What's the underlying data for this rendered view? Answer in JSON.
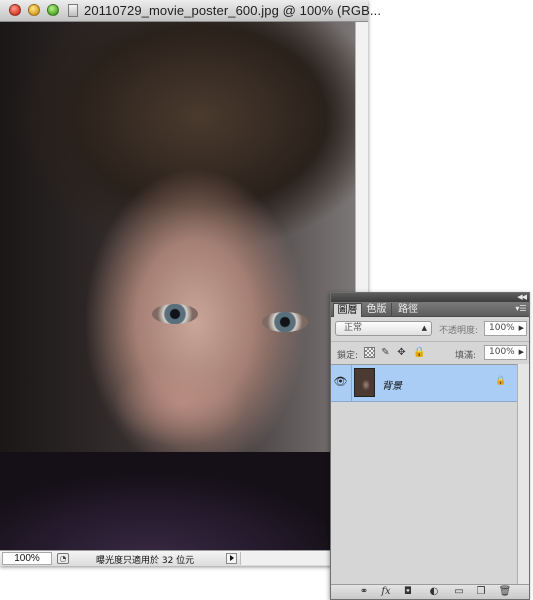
{
  "window": {
    "title": "20110729_movie_poster_600.jpg @ 100% (RGB..."
  },
  "status_bar": {
    "zoom": "100%",
    "info_text": "曝光度只適用於 32 位元"
  },
  "layers_panel": {
    "tabs": [
      "圖層",
      "色版",
      "路徑"
    ],
    "active_tab": "圖層",
    "blend_mode": "正常",
    "opacity_label": "不透明度:",
    "opacity_value": "100%",
    "lock_label": "鎖定:",
    "fill_label": "填滿:",
    "fill_value": "100%",
    "layers": [
      {
        "name": "背景",
        "visible": true,
        "locked": true,
        "selected": true
      }
    ]
  },
  "colors": {
    "layer_selected": "#a9cdf5",
    "panel_bg": "#d6d6d6"
  }
}
